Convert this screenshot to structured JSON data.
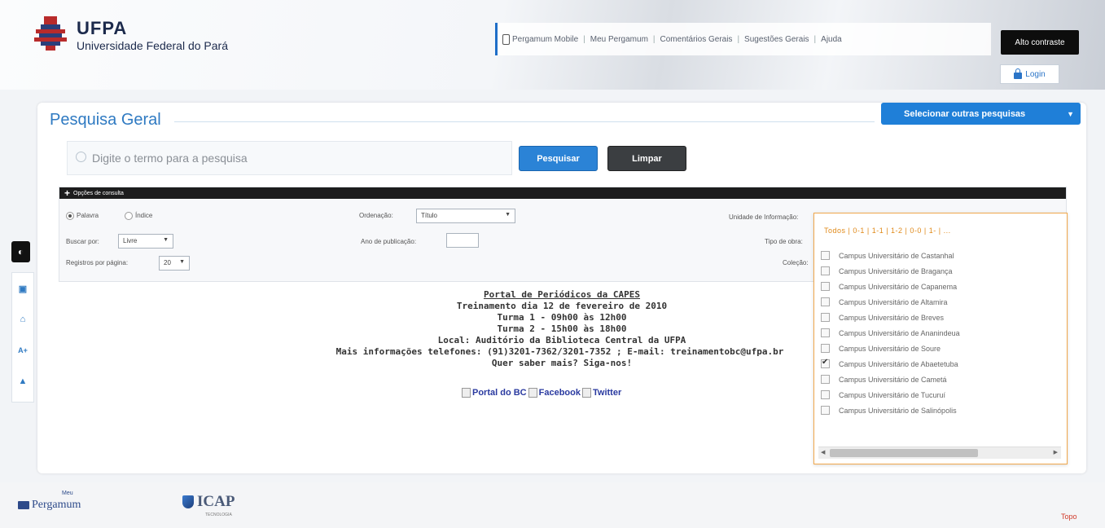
{
  "header": {
    "logo_title": "UFPA",
    "logo_subtitle": "Universidade Federal do Pará",
    "nav": [
      {
        "label": "Pergamum Mobile",
        "icon": "mobile-icon"
      },
      {
        "label": "Meu Pergamum"
      },
      {
        "label": "Comentários Gerais"
      },
      {
        "label": "Sugestões Gerais"
      },
      {
        "label": "Ajuda"
      }
    ],
    "nav_separator": "|",
    "contrast_label": "Alto contraste",
    "login_label": "Login"
  },
  "main": {
    "title": "Pesquisa Geral",
    "other_search_label": "Selecionar outras pesquisas",
    "search": {
      "placeholder": "Digite o termo para a pesquisa",
      "value": "",
      "search_button": "Pesquisar",
      "clear_button": "Limpar"
    },
    "options": {
      "header": "Opções de consulta",
      "radio_livre": "Palavra",
      "radio_indice": "Índice",
      "ordenacao_label": "Ordenação:",
      "ordenacao_value": "Título",
      "unidade_label": "Unidade de Informação:",
      "buscar_label": "Buscar por:",
      "buscar_value": "Livre",
      "ano_label": "Ano de publicação:",
      "tipo_label": "Tipo de obra:",
      "registros_label": "Registros por página:",
      "registros_value": "20",
      "colecao_label": "Coleção:"
    }
  },
  "info": {
    "lines": [
      "Portal de Periódicos da CAPES",
      "Treinamento dia 12 de fevereiro de 2010",
      "Turma 1 - 09h00 às 12h00",
      "Turma 2 - 15h00 às 18h00",
      "Local: Auditório da Biblioteca Central da UFPA",
      "Mais informações telefones: (91)3201-7362/3201-7352 ; E-mail: treinamentobc@ufpa.br",
      "Quer saber mais? Siga-nos!"
    ],
    "social": [
      "Portal do BC",
      "Facebook",
      "Twitter"
    ]
  },
  "dropdown": {
    "nav": "Todos | 0-1 | 1-1 | 1-2 | 0-0 | 1- | ...",
    "items": [
      {
        "label": "Campus Universitário de Castanhal",
        "checked": false
      },
      {
        "label": "Campus Universitário de Bragança",
        "checked": false
      },
      {
        "label": "Campus Universitário de Capanema",
        "checked": false
      },
      {
        "label": "Campus Universitário de Altamira",
        "checked": false
      },
      {
        "label": "Campus Universitário de Breves",
        "checked": false
      },
      {
        "label": "Campus Universitário de Ananindeua",
        "checked": false
      },
      {
        "label": "Campus Universitário de Soure",
        "checked": false
      },
      {
        "label": "Campus Universitário de Abaetetuba",
        "checked": true
      },
      {
        "label": "Campus Universitário de Cametá",
        "checked": false
      },
      {
        "label": "Campus Universitário de Tucuruí",
        "checked": false
      },
      {
        "label": "Campus Universitário de Salinópolis",
        "checked": false
      }
    ]
  },
  "a11y": {
    "dark_icon": "contrast-icon",
    "icons": [
      "sitemap-icon",
      "home-icon",
      "font-size-icon",
      "scroll-top-icon"
    ],
    "font_label": "A+"
  },
  "footer": {
    "pergamum_label": "Pergamum",
    "meu_label": "Meu",
    "icap_label": "ICAP",
    "icap_sub": "TECNOLOGIA",
    "link_label": "Topo"
  },
  "colors": {
    "accent": "#2f7ac2",
    "primary_button": "#2b83d6",
    "dark_button": "#3b3e41",
    "dropdown_border": "#f0a84d"
  }
}
